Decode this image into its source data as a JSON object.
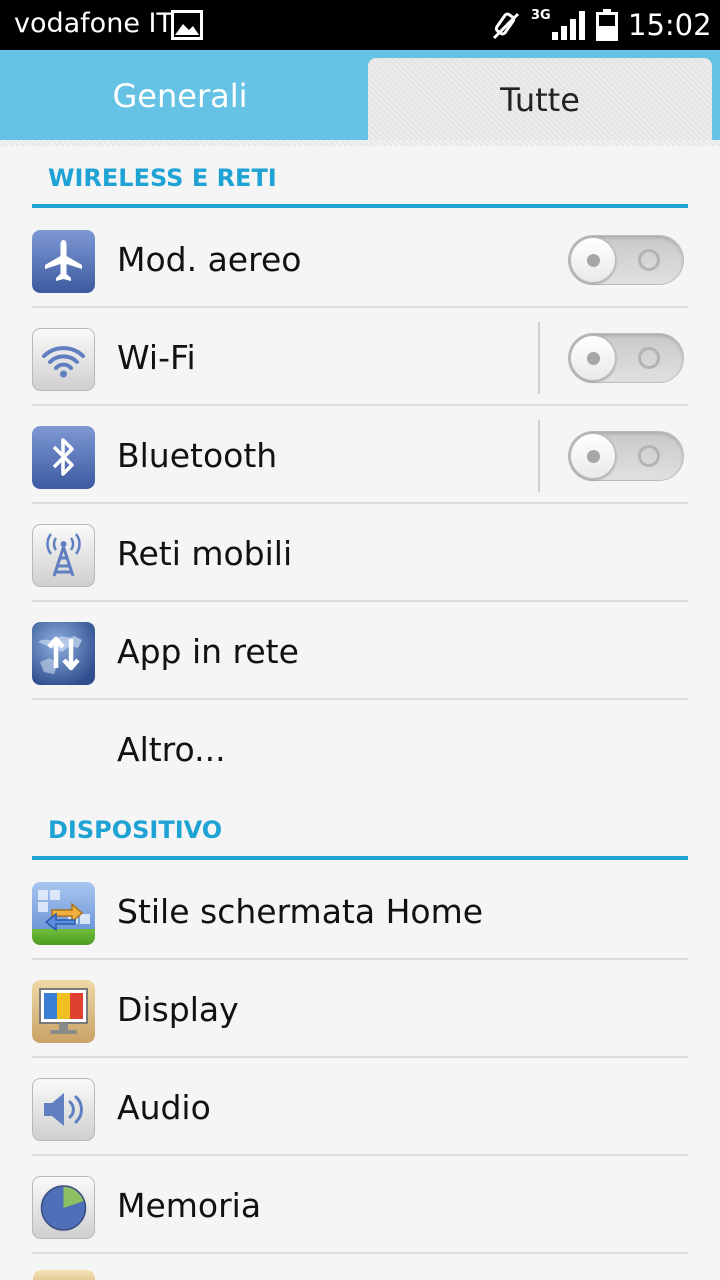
{
  "status_bar": {
    "carrier": "vodafone IT",
    "network_type": "3G",
    "time": "15:02",
    "icons": [
      "gallery-icon",
      "mute-icon",
      "signal-icon",
      "battery-icon"
    ]
  },
  "tabs": [
    {
      "label": "Generali",
      "selected": false
    },
    {
      "label": "Tutte",
      "selected": true
    }
  ],
  "sections": {
    "wireless": {
      "title": "WIRELESS E RETI",
      "items": [
        {
          "label": "Mod. aereo",
          "icon": "airplane-icon",
          "toggle": "off"
        },
        {
          "label": "Wi-Fi",
          "icon": "wifi-icon",
          "toggle": "off"
        },
        {
          "label": "Bluetooth",
          "icon": "bluetooth-icon",
          "toggle": "off"
        },
        {
          "label": "Reti mobili",
          "icon": "antenna-icon"
        },
        {
          "label": "App in rete",
          "icon": "globe-arrows-icon"
        },
        {
          "label": "Altro..."
        }
      ]
    },
    "device": {
      "title": "DISPOSITIVO",
      "items": [
        {
          "label": "Stile schermata Home",
          "icon": "home-style-icon"
        },
        {
          "label": "Display",
          "icon": "display-icon"
        },
        {
          "label": "Audio",
          "icon": "speaker-icon"
        },
        {
          "label": "Memoria",
          "icon": "storage-pie-icon"
        }
      ]
    }
  },
  "colors": {
    "accent": "#1fa3d4",
    "tab_bar": "#65c2e4",
    "background": "#f5f5f5"
  }
}
